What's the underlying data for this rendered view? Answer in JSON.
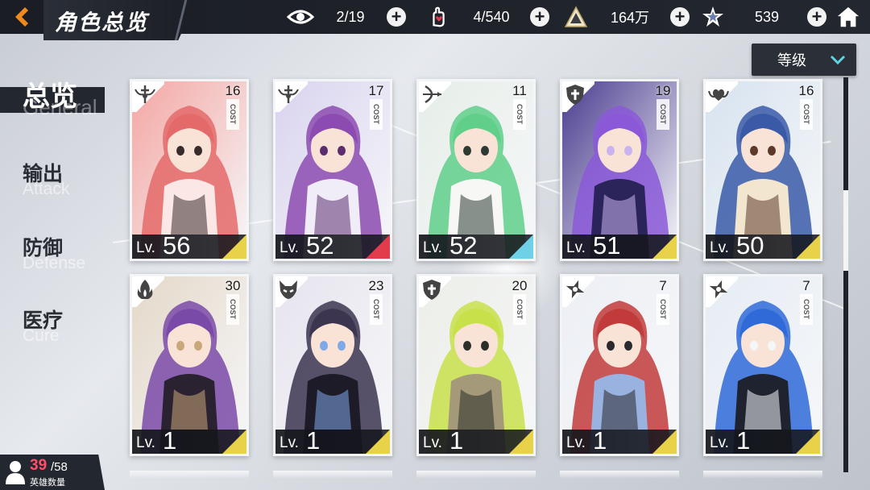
{
  "header": {
    "title": "角色总览",
    "resources": [
      {
        "icon": "eye-icon",
        "value": "2/19"
      },
      {
        "icon": "hand-heart-icon",
        "value": "4/540"
      },
      {
        "icon": "triangle-crystal-icon",
        "value": "164万"
      },
      {
        "icon": "star-shard-icon",
        "value": "539"
      }
    ]
  },
  "sort": {
    "selected": "等级"
  },
  "sidebar": {
    "items": [
      {
        "cn": "总览",
        "en": "General",
        "active": true
      },
      {
        "cn": "输出",
        "en": "Attack",
        "active": false
      },
      {
        "cn": "防御",
        "en": "Defense",
        "active": false
      },
      {
        "cn": "医疗",
        "en": "Cure",
        "active": false
      }
    ]
  },
  "hero_count": {
    "owned": "39",
    "total": "/58",
    "label": "英雄数量"
  },
  "cards": [
    {
      "cost": "16",
      "cost_label": "COST",
      "level_prefix": "Lv.",
      "level": "56",
      "class_icon": "winged-sword-icon",
      "accent": "#e8d24a",
      "palette": [
        "#f3a7a3",
        "#e46a6a",
        "#fbe8e6",
        "#3a2b2b"
      ]
    },
    {
      "cost": "17",
      "cost_label": "COST",
      "level_prefix": "Lv.",
      "level": "52",
      "class_icon": "winged-sword-icon",
      "accent": "#e23b4c",
      "palette": [
        "#d9d3ef",
        "#8c4bb0",
        "#f1edf8",
        "#5b2d70"
      ]
    },
    {
      "cost": "11",
      "cost_label": "COST",
      "level_prefix": "Lv.",
      "level": "52",
      "class_icon": "bow-arrow-icon",
      "accent": "#6ed1e8",
      "palette": [
        "#e6eee8",
        "#5fcf8a",
        "#f7f8f6",
        "#2e3a33"
      ]
    },
    {
      "cost": "19",
      "cost_label": "COST",
      "level_prefix": "Lv.",
      "level": "51",
      "class_icon": "shield-cross-icon",
      "accent": "#e8d24a",
      "palette": [
        "#4a3c8f",
        "#8b59d8",
        "#2b245a",
        "#c9b3f0"
      ]
    },
    {
      "cost": "16",
      "cost_label": "COST",
      "level_prefix": "Lv.",
      "level": "50",
      "class_icon": "winged-heart-icon",
      "accent": "#e8d24a",
      "palette": [
        "#d7e3ef",
        "#3a5aa8",
        "#f3e6cf",
        "#5b3a2a"
      ]
    },
    {
      "cost": "30",
      "cost_label": "COST",
      "level_prefix": "Lv.",
      "level": "1",
      "class_icon": "flame-icon",
      "accent": "#e8d24a",
      "palette": [
        "#e4d8c8",
        "#7a4aa8",
        "#2a2230",
        "#c8a77a"
      ]
    },
    {
      "cost": "23",
      "cost_label": "COST",
      "level_prefix": "Lv.",
      "level": "1",
      "class_icon": "fox-mask-icon",
      "accent": "#e8d24a",
      "palette": [
        "#e6e4ee",
        "#3b3550",
        "#1e1b28",
        "#7fa8e8"
      ]
    },
    {
      "cost": "20",
      "cost_label": "COST",
      "level_prefix": "Lv.",
      "level": "1",
      "class_icon": "shield-cross-icon",
      "accent": "#e8d24a",
      "palette": [
        "#eceee8",
        "#c8e04a",
        "#a49a7a",
        "#2c2e2a"
      ]
    },
    {
      "cost": "7",
      "cost_label": "COST",
      "level_prefix": "Lv.",
      "level": "1",
      "class_icon": "shuriken-icon",
      "accent": "#e8d24a",
      "palette": [
        "#eceff4",
        "#c23b3b",
        "#9ab2e0",
        "#2a2a2e"
      ]
    },
    {
      "cost": "7",
      "cost_label": "COST",
      "level_prefix": "Lv.",
      "level": "1",
      "class_icon": "shuriken-icon",
      "accent": "#e8d24a",
      "palette": [
        "#e6ecf4",
        "#2f6ad8",
        "#1f2330",
        "#f4f6f8"
      ]
    }
  ],
  "colors": {
    "accent_orange": "#f08a1c",
    "bar_dark": "#23272f",
    "cost_red": "#ff4f6a"
  }
}
